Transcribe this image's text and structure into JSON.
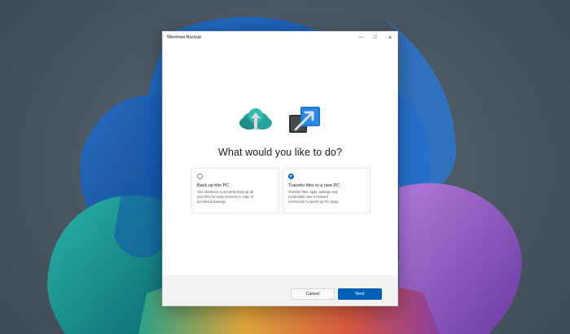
{
  "window": {
    "title": "Windows Backup",
    "controls": {
      "minimize": "─",
      "maximize": "□",
      "close": "✕"
    }
  },
  "main": {
    "heading": "What would you like to do?",
    "options": [
      {
        "title": "Back up this PC",
        "desc_lines": [
          "Use OneDrive to securely back up all",
          "your files for easy recovery in case of",
          "accidental damage"
        ],
        "selected": false
      },
      {
        "title": "Transfer files to a new PC",
        "desc_lines": [
          "Transfer files, apps, settings and",
          "credentials over a network",
          "connection to speed up PC setup"
        ],
        "selected": true
      }
    ]
  },
  "footer": {
    "cancel_label": "Cancel",
    "next_label": "Next"
  },
  "icons": {
    "cloud": "cloud-upload-icon",
    "transfer": "pc-transfer-icon"
  },
  "colors": {
    "accent": "#0067c0",
    "primary_button": "#005fb8",
    "cloud_teal": "#2fa7a0"
  }
}
